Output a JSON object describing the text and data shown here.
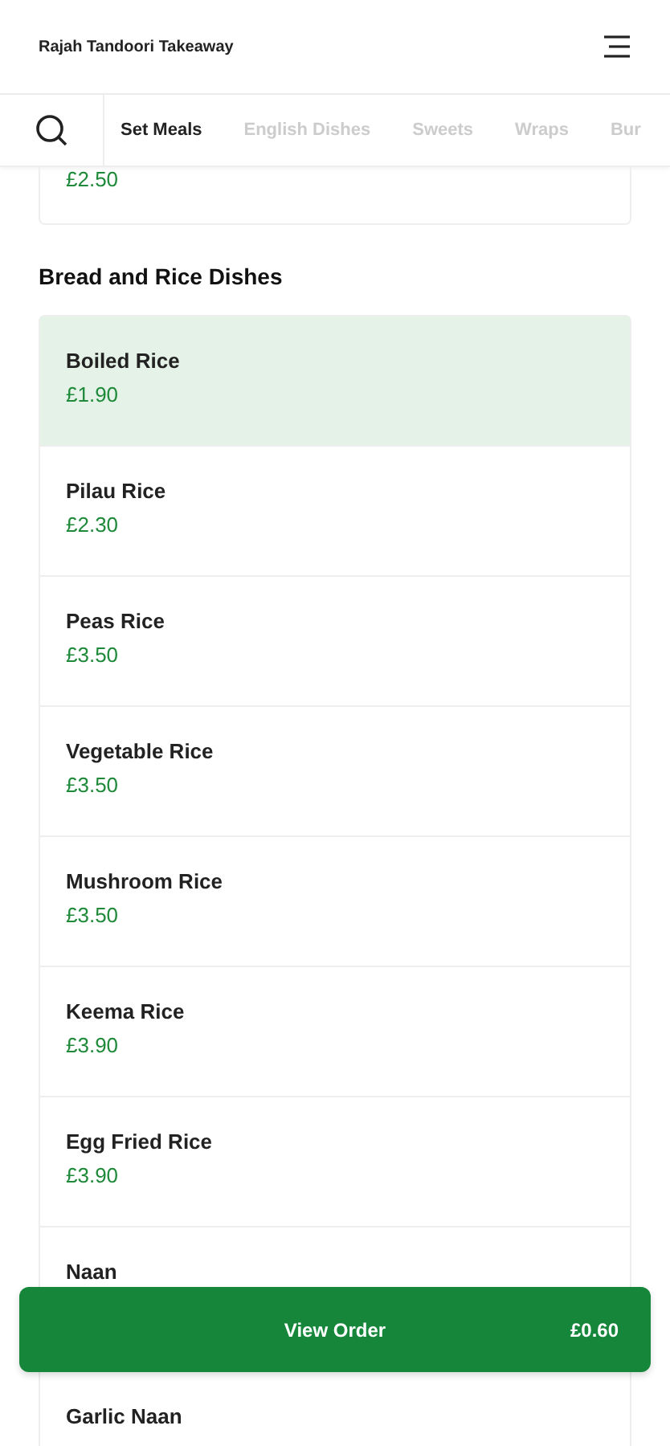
{
  "header": {
    "title": "Rajah Tandoori Takeaway"
  },
  "tabs": [
    {
      "label": "Set Meals",
      "selected": true
    },
    {
      "label": "English Dishes",
      "selected": false
    },
    {
      "label": "Sweets",
      "selected": false
    },
    {
      "label": "Wraps",
      "selected": false
    },
    {
      "label": "Bur",
      "selected": false
    }
  ],
  "previous_item": {
    "price": "£2.50"
  },
  "section": {
    "title": "Bread and Rice Dishes",
    "items": [
      {
        "name": "Boiled Rice",
        "price": "£1.90",
        "selected": true
      },
      {
        "name": "Pilau Rice",
        "price": "£2.30",
        "selected": false
      },
      {
        "name": "Peas Rice",
        "price": "£3.50",
        "selected": false
      },
      {
        "name": "Vegetable Rice",
        "price": "£3.50",
        "selected": false
      },
      {
        "name": "Mushroom Rice",
        "price": "£3.50",
        "selected": false
      },
      {
        "name": "Keema Rice",
        "price": "£3.90",
        "selected": false
      },
      {
        "name": "Egg Fried Rice",
        "price": "£3.90",
        "selected": false
      },
      {
        "name": "Naan",
        "selected": false
      },
      {
        "name": "Garlic Naan",
        "selected": false
      }
    ]
  },
  "order_bar": {
    "label": "View Order",
    "total": "£0.60"
  }
}
